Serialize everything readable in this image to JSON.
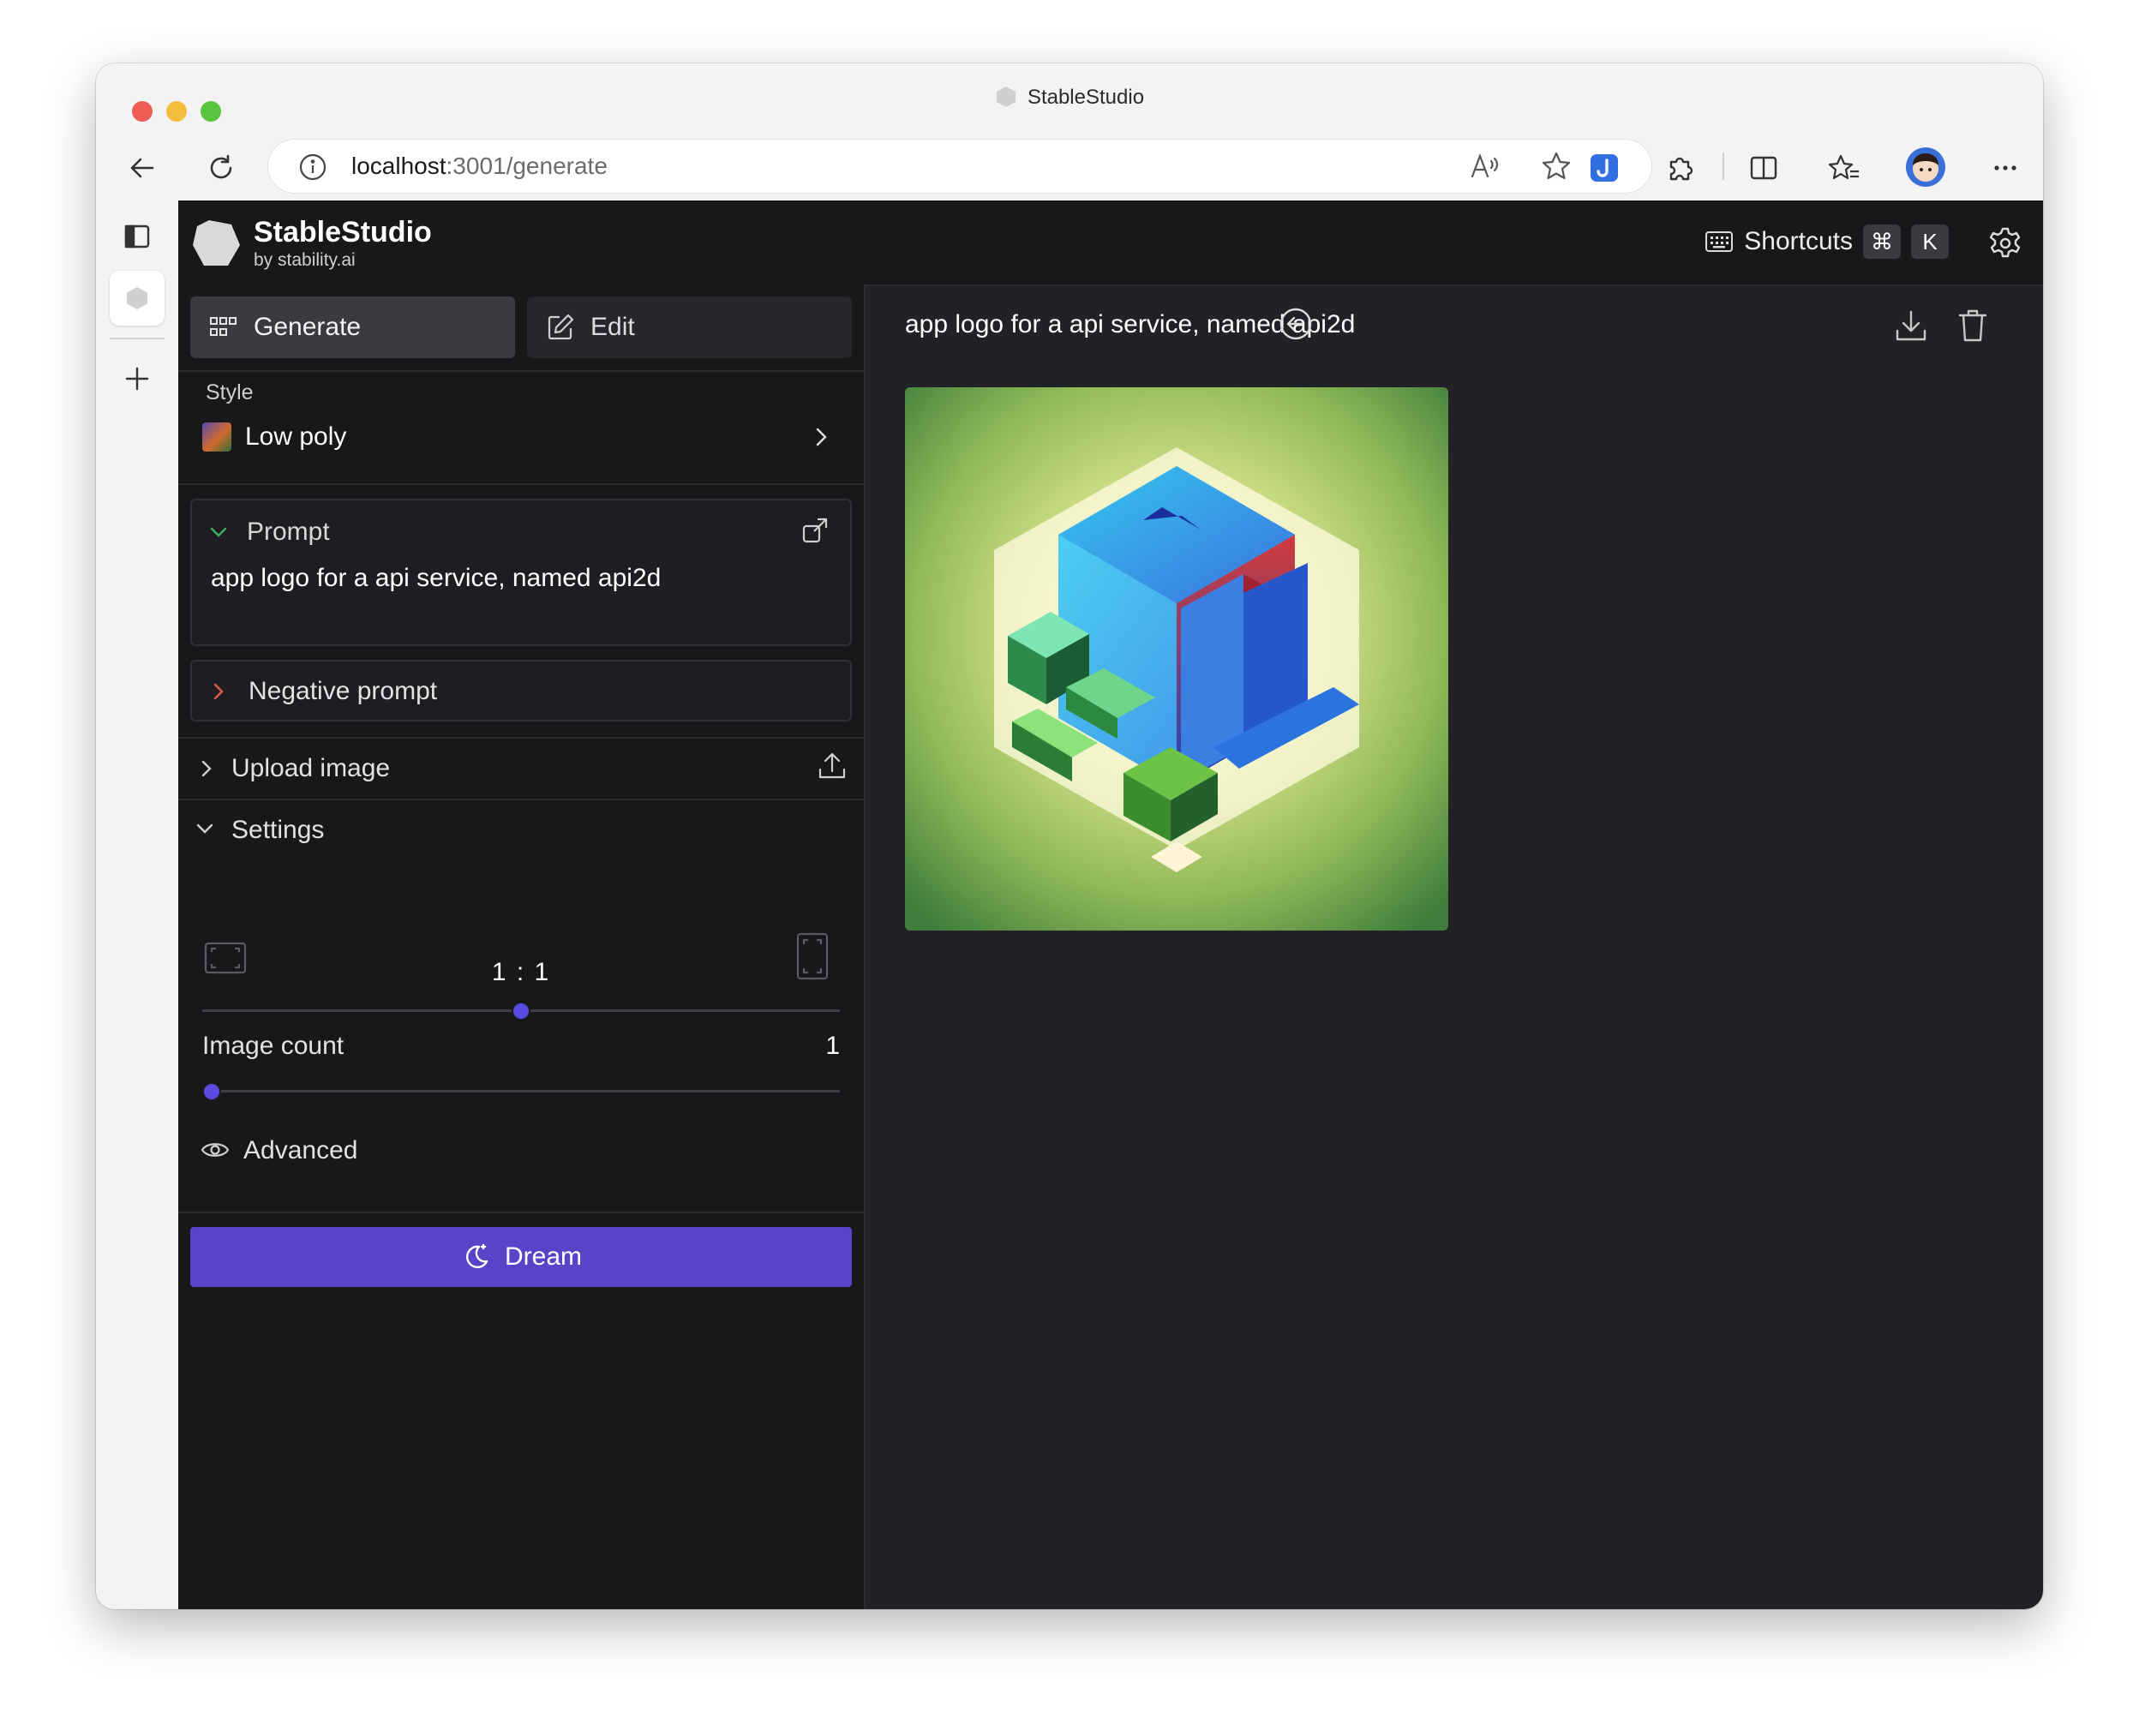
{
  "browser": {
    "tab_title": "StableStudio",
    "url_host": "localhost",
    "url_path": ":3001/generate"
  },
  "app": {
    "brand_name": "StableStudio",
    "brand_by": "by stability.ai",
    "shortcuts_label": "Shortcuts",
    "shortcut_keys": [
      "⌘",
      "K"
    ]
  },
  "panel": {
    "tabs": [
      {
        "label": "Generate",
        "active": true
      },
      {
        "label": "Edit",
        "active": false
      }
    ],
    "style_label": "Style",
    "style_value": "Low poly",
    "prompt_title": "Prompt",
    "prompt_text": "app logo for a api service, named api2d",
    "negative_prompt_title": "Negative prompt",
    "upload_image_label": "Upload image",
    "settings_label": "Settings",
    "aspect_ratio": "1 : 1",
    "aspect_slider_fraction": 0.5,
    "image_count_label": "Image count",
    "image_count_value": "1",
    "image_count_fraction": 0.0,
    "advanced_label": "Advanced",
    "dream_label": "Dream"
  },
  "main": {
    "title": "app logo for a api service, named api2d"
  },
  "colors": {
    "accent": "#5a43c9",
    "slider_thumb": "#5b4be0",
    "panel_bg": "#18181b",
    "main_bg": "#222226"
  }
}
